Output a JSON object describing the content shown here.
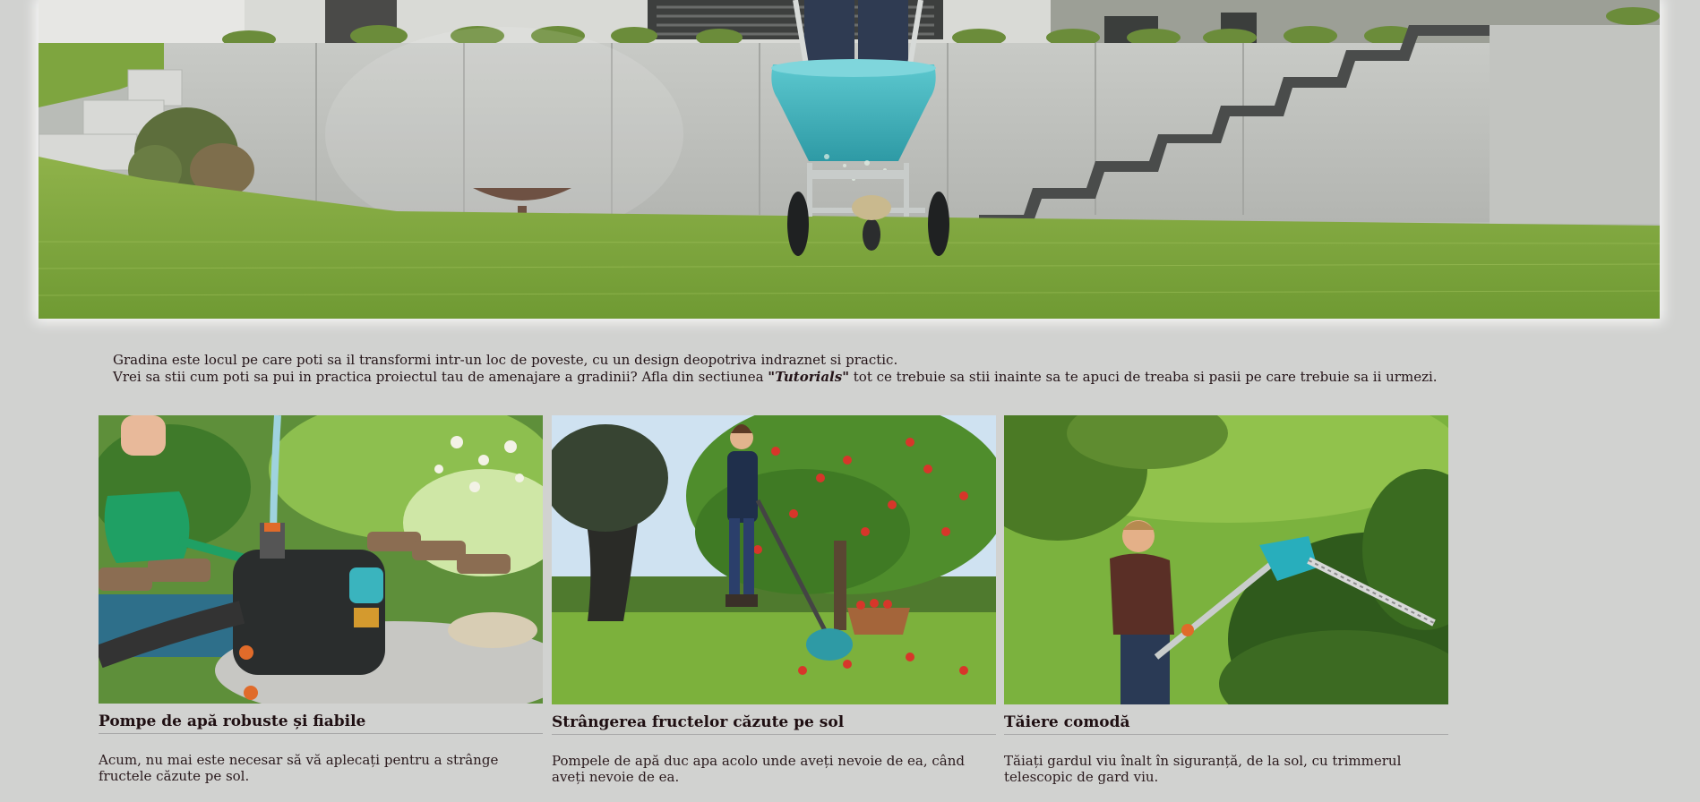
{
  "hero": {
    "image_alt": "garden-lawn-spreader-hero"
  },
  "intro": {
    "line1": "Gradina este locul pe care poti sa il transformi intr-un loc de poveste, cu un design deopotriva indraznet si practic.",
    "line2_before": "Vrei sa stii cum poti sa pui in practica proiectul tau de amenajare a gradinii? Afla din sectiunea ",
    "line2_link": "\"Tutorials\"",
    "line2_after": " tot ce trebuie sa stii inainte sa te apuci de treaba si pasii pe care trebuie sa ii urmezi."
  },
  "cards": [
    {
      "title": "Pompe de apă robuste și fiabile",
      "text": "Acum, nu mai este necesar să vă aplecați pentru a strânge fructele căzute pe sol."
    },
    {
      "title": "Strângerea fructelor căzute pe sol",
      "text": "Pompele de apă duc apa acolo unde aveți nevoie de ea, când aveți nevoie de ea."
    },
    {
      "title": "Tăiere comodă",
      "text": "Tăiați gardul viu înalt în siguranță, de la sol, cu trimmerul telescopic de gard viu."
    }
  ],
  "colors": {
    "page_background": "#d1d2d0",
    "text": "#241418",
    "spreader_teal": "#3fb5bf",
    "lawn_green": "#7aa53c"
  }
}
